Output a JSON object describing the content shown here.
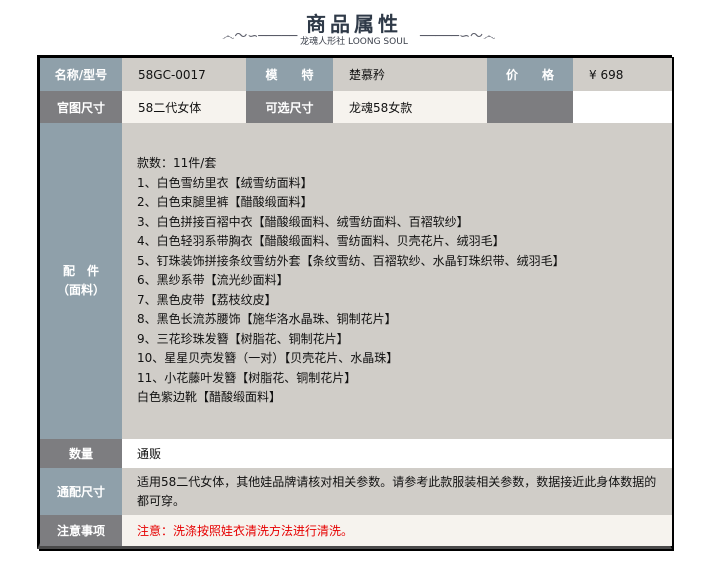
{
  "header": {
    "title": "商品属性",
    "subtitle": "龙魂人形社 LOONG SOUL"
  },
  "row1": {
    "name_label": "名称/型号",
    "name_value": "58GC-0017",
    "model_label": "模　　特",
    "model_value": "楚慕矜",
    "price_label": "价　　格",
    "price_value": "¥ 698"
  },
  "row2": {
    "size_label": "官图尺寸",
    "size_value": "58二代女体",
    "optional_label": "可选尺寸",
    "optional_value": "龙魂58女款"
  },
  "parts": {
    "label": "配　件",
    "sublabel": "（面料）",
    "items": [
      "款数：11件/套",
      "1、白色雪纺里衣【绒雪纺面料】",
      "2、白色束腿里裤【醋酸缎面料】",
      "3、白色拼接百褶中衣【醋酸缎面料、绒雪纺面料、百褶软纱】",
      "4、白色轻羽系带胸衣【醋酸缎面料、雪纺面料、贝壳花片、绒羽毛】",
      "5、钉珠装饰拼接条纹雪纺外套【条纹雪纺、百褶软纱、水晶钉珠织带、绒羽毛】",
      "6、黑纱系带【流光纱面料】",
      "7、黑色皮带【荔枝纹皮】",
      "8、黑色长流苏腰饰【施华洛水晶珠、铜制花片】",
      "9、三花珍珠发簪【树脂花、铜制花片】",
      "10、星星贝壳发簪（一对）【贝壳花片、水晶珠】",
      "11、小花藤叶发簪【树脂花、铜制花片】",
      "白色紫边靴【醋酸缎面料】"
    ]
  },
  "quantity": {
    "label": "数量",
    "value": "通贩"
  },
  "fit": {
    "label": "通配尺寸",
    "value": "适用58二代女体，其他娃品牌请核对相关参数。请参考此款服装相关参数，数据接近此身体数据的都可穿。"
  },
  "notice": {
    "label": "注意事项",
    "value": "注意：洗涤按照娃衣清洗方法进行清洗。"
  }
}
